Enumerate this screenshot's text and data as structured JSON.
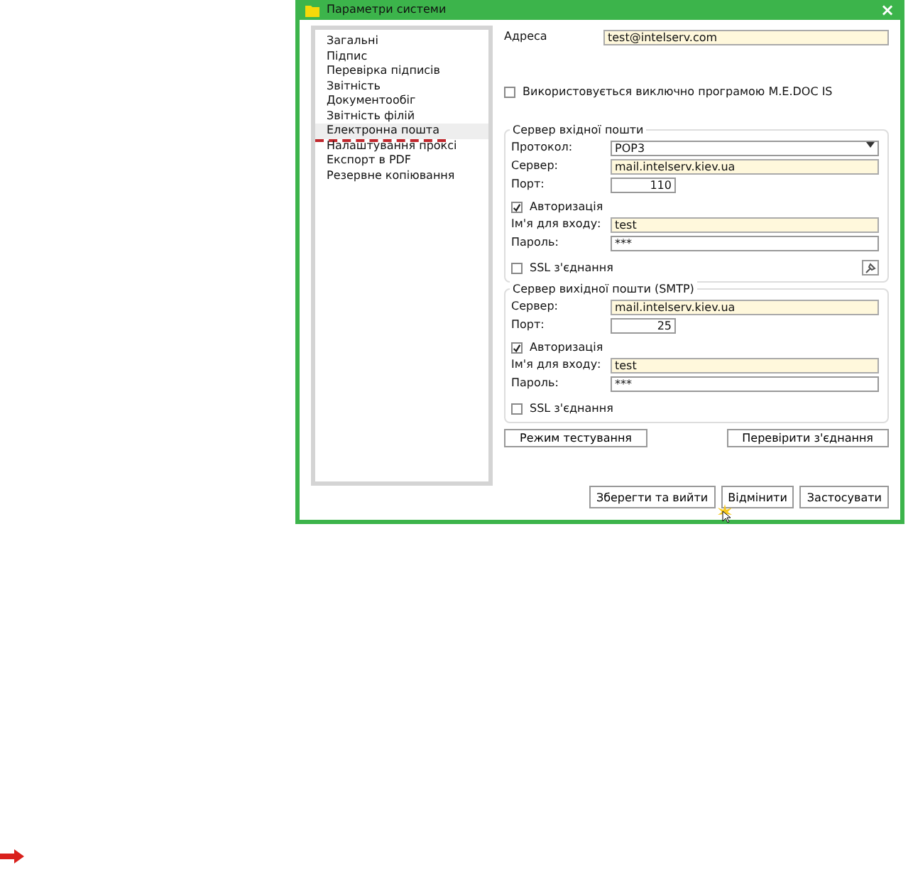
{
  "window": {
    "title": "Параметри системи",
    "close": "×"
  },
  "sidebar": {
    "items": [
      {
        "label": "Загальні",
        "selected": false
      },
      {
        "label": "Підпис",
        "selected": false
      },
      {
        "label": "Перевірка підписів",
        "selected": false
      },
      {
        "label": "Звітність",
        "selected": false
      },
      {
        "label": "Документообіг",
        "selected": false
      },
      {
        "label": "Звітність філій",
        "selected": false
      },
      {
        "label": "Електронна пошта",
        "selected": true
      },
      {
        "label": "Налаштування проксі",
        "selected": false
      },
      {
        "label": "Експорт в PDF",
        "selected": false
      },
      {
        "label": "Резервне копіювання",
        "selected": false
      }
    ]
  },
  "address": {
    "label": "Адреса",
    "value": "test@intelserv.com"
  },
  "exclusive": {
    "label": "Використовується виключно програмою M.E.DOC IS",
    "checked": false
  },
  "groups": [
    {
      "legend": "Сервер вхідної пошти",
      "protocol": {
        "label": "Протокол:",
        "value": "POP3"
      },
      "server": {
        "label": "Сервер:",
        "value": "mail.intelserv.kiev.ua"
      },
      "port": {
        "label": "Порт:",
        "value": "110"
      },
      "auth": {
        "label": "Авторизація",
        "checked": true
      },
      "login": {
        "label": "Ім'я для входу:",
        "value": "test"
      },
      "password": {
        "label": "Пароль:",
        "value": "***"
      },
      "ssl": {
        "label": "SSL з'єднання",
        "checked": false
      },
      "tool_button": true
    },
    {
      "legend": "Сервер вихідної пошти (SMTP)",
      "server": {
        "label": "Сервер:",
        "value": "mail.intelserv.kiev.ua"
      },
      "port": {
        "label": "Порт:",
        "value": "25"
      },
      "auth": {
        "label": "Авторизація",
        "checked": true
      },
      "login": {
        "label": "Ім'я для входу:",
        "value": "test"
      },
      "password": {
        "label": "Пароль:",
        "value": "***"
      },
      "ssl": {
        "label": "SSL з'єднання",
        "checked": false
      },
      "tool_button": false
    }
  ],
  "test_buttons": [
    "Режим тестування",
    "Перевірити з'єднання"
  ],
  "footer_buttons": [
    "Зберегти та вийти",
    "Відмінити",
    "Застосувати"
  ]
}
